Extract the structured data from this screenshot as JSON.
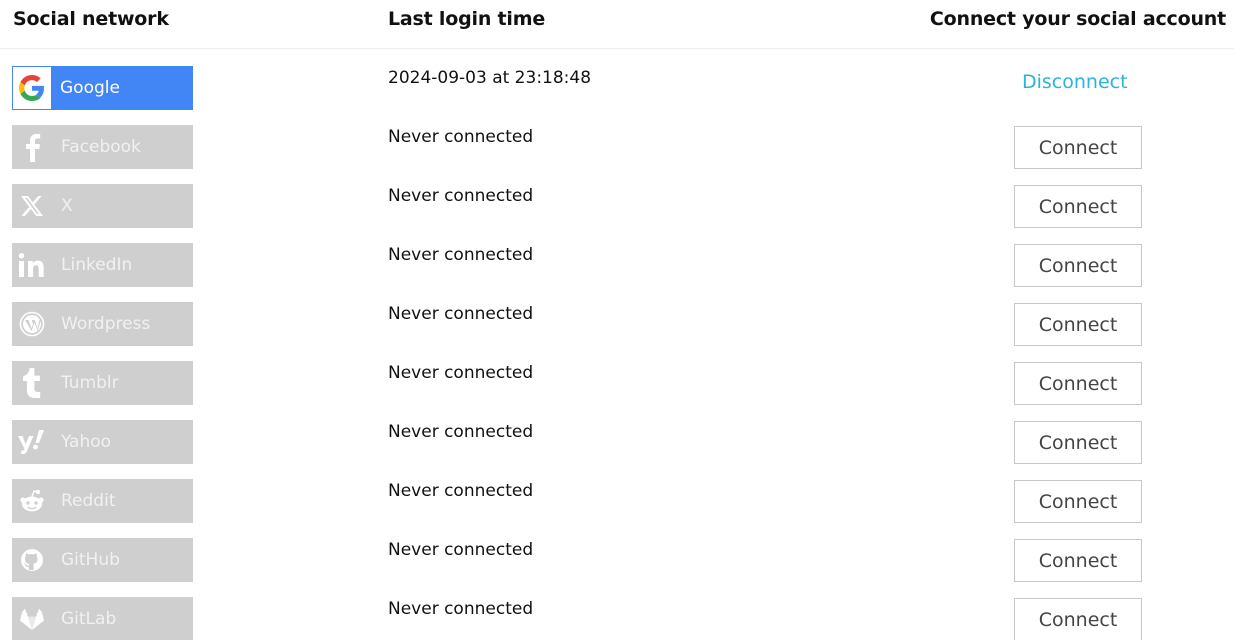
{
  "header": {
    "col_network": "Social network",
    "col_login": "Last login time",
    "col_connect": "Connect your social account"
  },
  "rows": [
    {
      "network": "Google",
      "icon": "google-icon",
      "last_login": "2024-09-03 at 23:18:48",
      "action": "Disconnect",
      "connected": true
    },
    {
      "network": "Facebook",
      "icon": "facebook-icon",
      "last_login": "Never connected",
      "action": "Connect",
      "connected": false
    },
    {
      "network": "X",
      "icon": "x-icon",
      "last_login": "Never connected",
      "action": "Connect",
      "connected": false
    },
    {
      "network": "LinkedIn",
      "icon": "linkedin-icon",
      "last_login": "Never connected",
      "action": "Connect",
      "connected": false
    },
    {
      "network": "Wordpress",
      "icon": "wordpress-icon",
      "last_login": "Never connected",
      "action": "Connect",
      "connected": false
    },
    {
      "network": "Tumblr",
      "icon": "tumblr-icon",
      "last_login": "Never connected",
      "action": "Connect",
      "connected": false
    },
    {
      "network": "Yahoo",
      "icon": "yahoo-icon",
      "last_login": "Never connected",
      "action": "Connect",
      "connected": false
    },
    {
      "network": "Reddit",
      "icon": "reddit-icon",
      "last_login": "Never connected",
      "action": "Connect",
      "connected": false
    },
    {
      "network": "GitHub",
      "icon": "github-icon",
      "last_login": "Never connected",
      "action": "Connect",
      "connected": false
    },
    {
      "network": "GitLab",
      "icon": "gitlab-icon",
      "last_login": "Never connected",
      "action": "Connect",
      "connected": false
    }
  ],
  "colors": {
    "google_blue": "#4285f4",
    "inactive_gray": "#cfcfcf",
    "disconnect_cyan": "#2bb3d9"
  }
}
